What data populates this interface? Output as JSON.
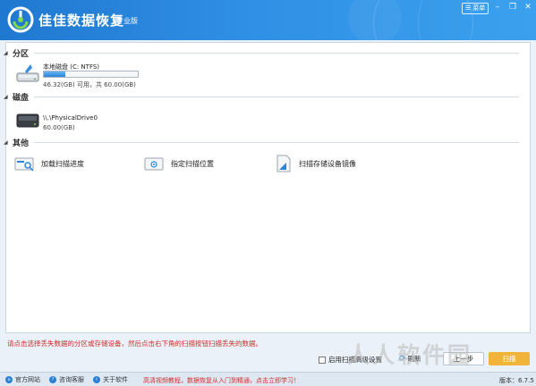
{
  "window": {
    "title": "佳佳数据恢复",
    "edition": "专业版",
    "menu_label": "菜单"
  },
  "sections": {
    "partition": "分区",
    "disk": "磁盘",
    "other": "其他"
  },
  "partition_drive": {
    "name": "本地磁盘 (C: NTFS)",
    "size_text": "46.32(GB) 可用，共 60.00(GB)",
    "used_fraction": 0.23
  },
  "physical_drive": {
    "name": "\\\\.\\PhysicalDrive0",
    "size_text": "60.00(GB)"
  },
  "other_items": [
    {
      "label": "加载扫描进度",
      "icon": "magnifier-folder-icon"
    },
    {
      "label": "指定扫描位置",
      "icon": "target-folder-icon"
    },
    {
      "label": "扫描存储设备镜像",
      "icon": "disk-image-icon"
    }
  ],
  "hint_text": "请点击选择丢失数据的分区或存储设备，然后点击右下角的扫描按钮扫描丢失的数据。",
  "controls": {
    "checkbox_label": "启用扫描高级设置",
    "refresh_label": "刷新",
    "prev_label": "上一步",
    "next_label": "扫描"
  },
  "status_bar": {
    "website": "官方网站",
    "support": "咨询客服",
    "about": "关于软件",
    "promo": "高清视频教程，数据恢复从入门到精通，点击立即学习！",
    "version": "版本：6.7.5"
  },
  "watermark": "人人软件园",
  "colors": {
    "title_bar": "#2f8fe4",
    "accent_blue": "#2a84d8",
    "hint_red": "#d32c2c",
    "next_button": "#f0b43a"
  }
}
